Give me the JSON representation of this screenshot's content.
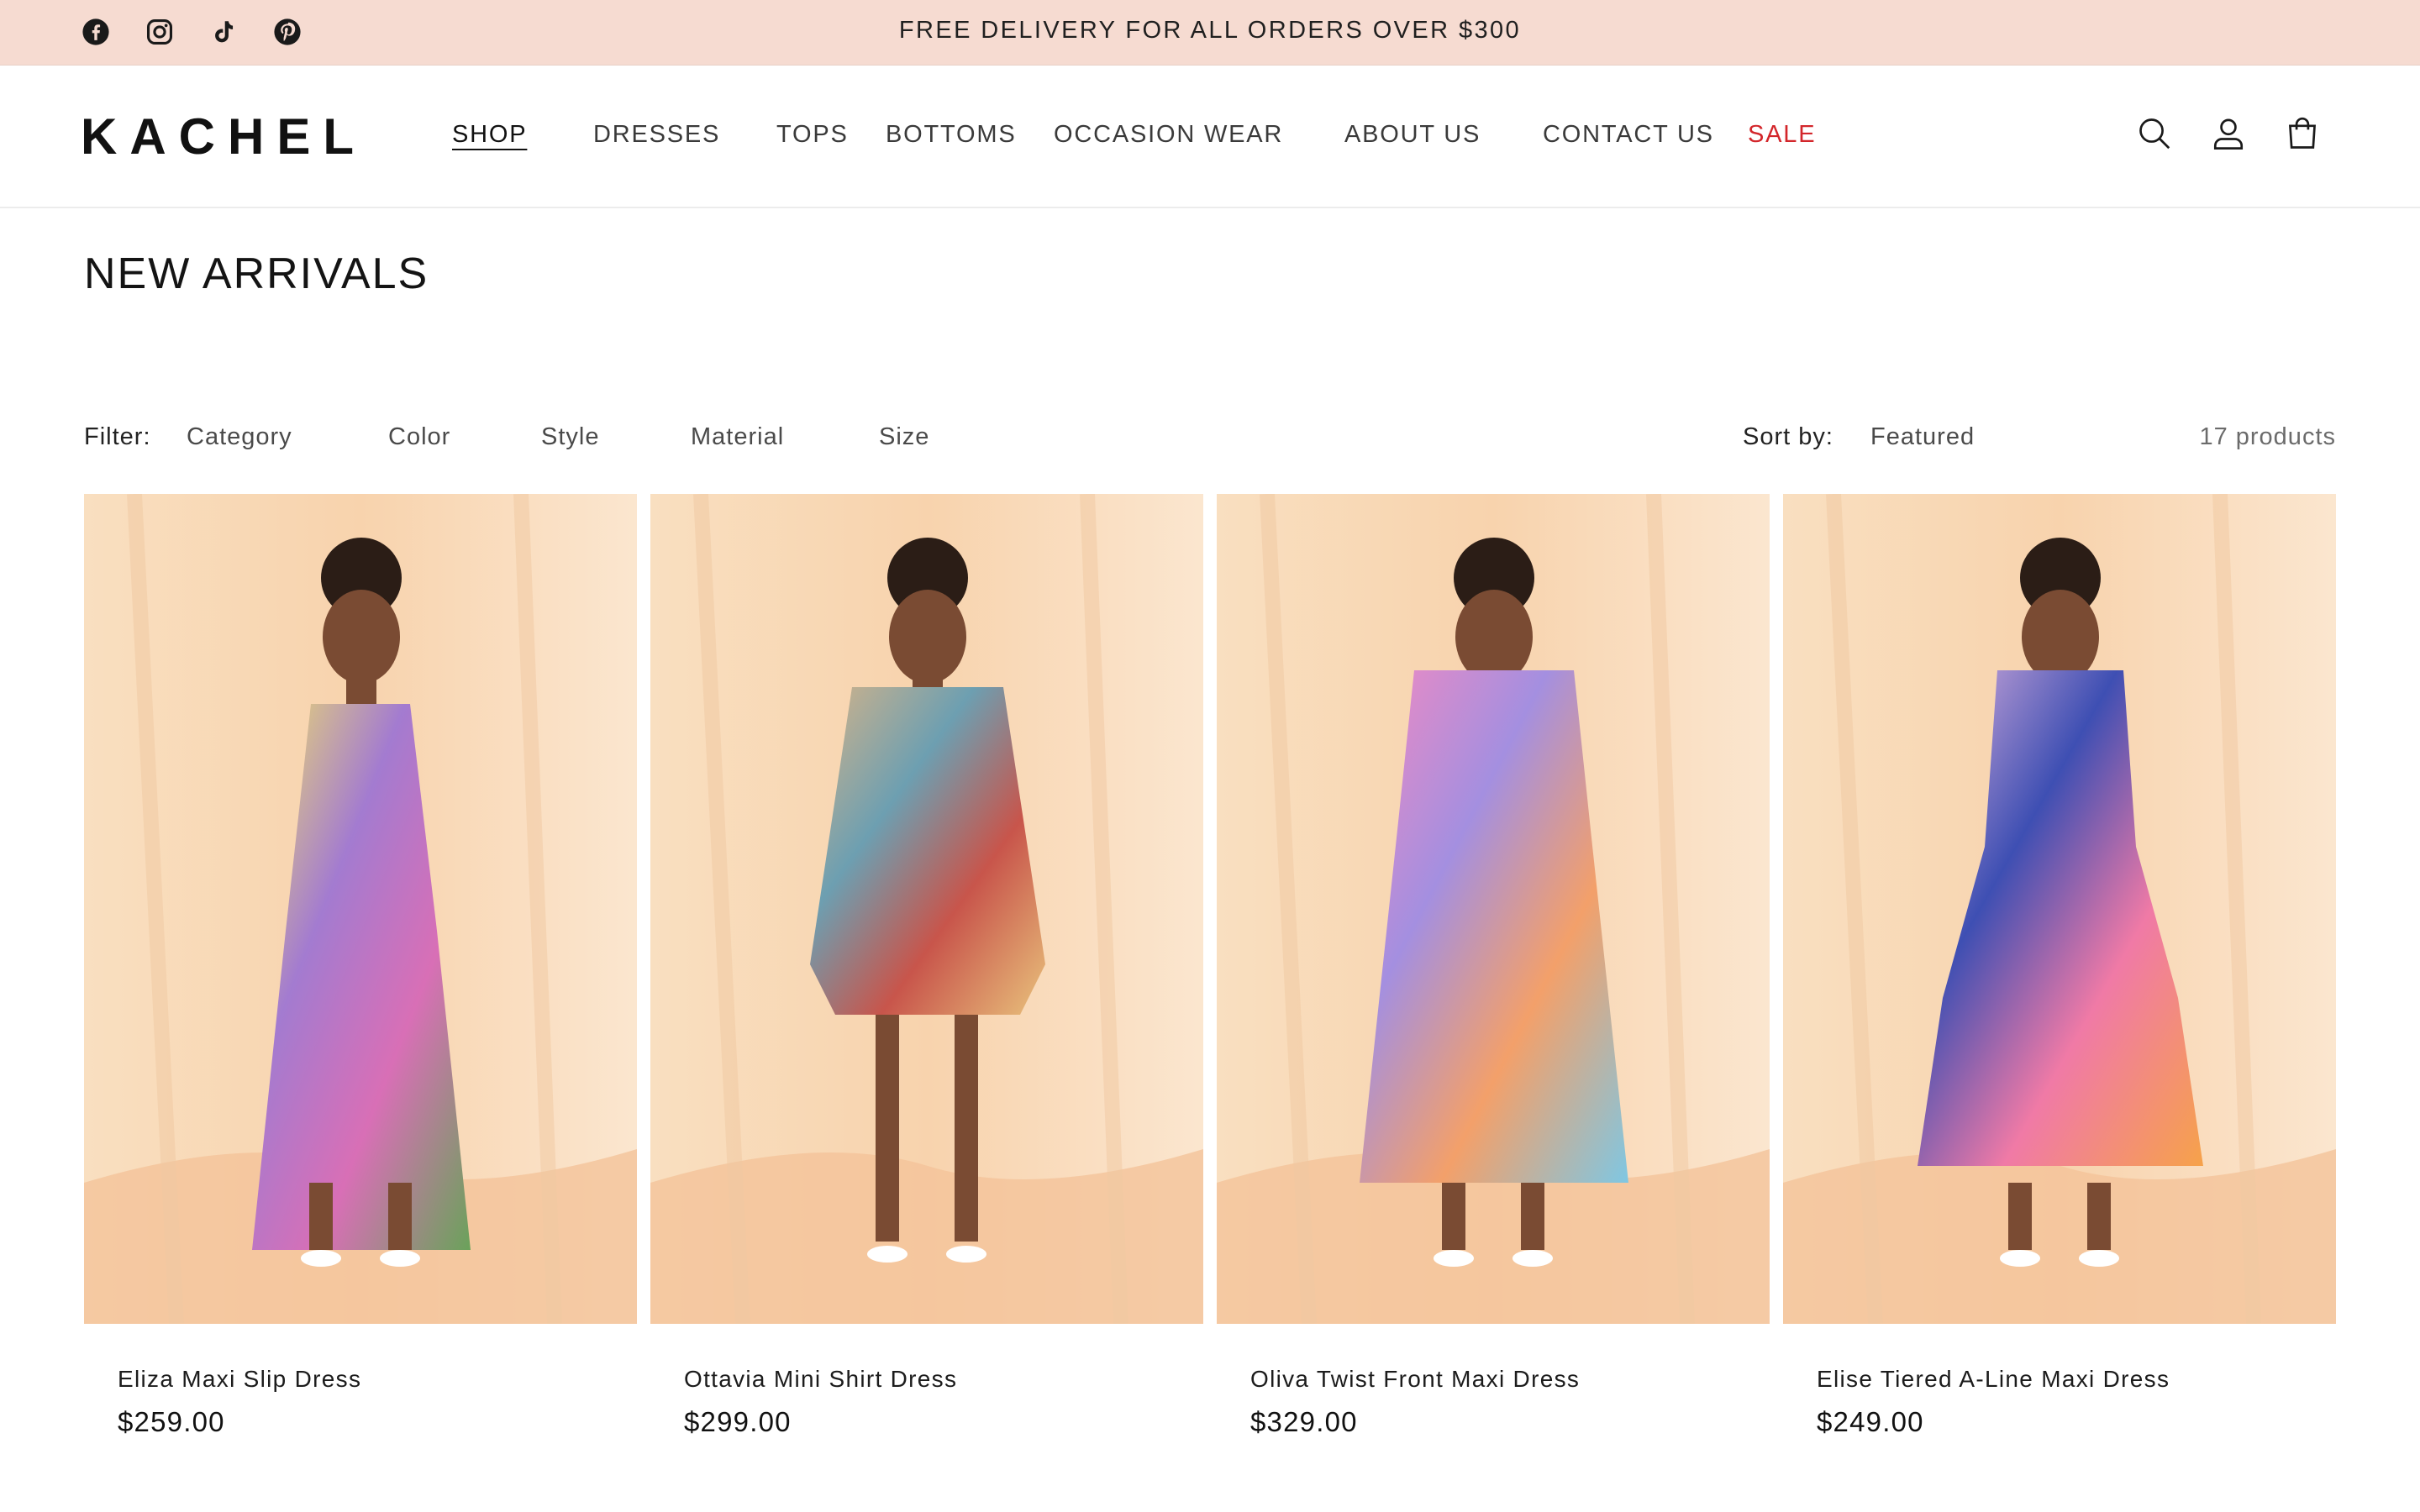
{
  "announcement": {
    "text": "FREE DELIVERY FOR ALL ORDERS OVER $300",
    "socials": [
      "facebook-icon",
      "instagram-icon",
      "tiktok-icon",
      "pinterest-icon"
    ]
  },
  "header": {
    "logo": "KACHEL",
    "nav": [
      {
        "label": "SHOP",
        "active": true
      },
      {
        "label": "DRESSES"
      },
      {
        "label": "TOPS"
      },
      {
        "label": "BOTTOMS"
      },
      {
        "label": "OCCASION WEAR"
      },
      {
        "label": "ABOUT US"
      },
      {
        "label": "CONTACT US"
      },
      {
        "label": "SALE",
        "color": "#d3262b"
      }
    ],
    "icons": [
      "search-icon",
      "account-icon",
      "cart-icon"
    ]
  },
  "page": {
    "title": "NEW ARRIVALS"
  },
  "facets": {
    "filter_label": "Filter:",
    "filters": [
      "Category",
      "Color",
      "Style",
      "Material",
      "Size"
    ],
    "sort_label": "Sort by:",
    "sort_value": "Featured",
    "count": "17 products"
  },
  "products": [
    {
      "title": "Eliza Maxi Slip Dress",
      "price": "$259.00",
      "dress_colors": [
        "#f3e468",
        "#a37bd0",
        "#d86fb6",
        "#6aa25a"
      ]
    },
    {
      "title": "Ottavia Mini Shirt Dress",
      "price": "$299.00",
      "dress_colors": [
        "#d9b487",
        "#6d9fb1",
        "#c8554b",
        "#e9c27c"
      ]
    },
    {
      "title": "Oliva Twist Front Maxi Dress",
      "price": "$329.00",
      "dress_colors": [
        "#f48ac1",
        "#a48fe0",
        "#f3a06a",
        "#7fc7e3"
      ]
    },
    {
      "title": "Elise Tiered A-Line Maxi Dress",
      "price": "$249.00",
      "dress_colors": [
        "#e9b9e0",
        "#3e4fb3",
        "#f07aa6",
        "#f6a24a"
      ]
    }
  ],
  "colors": {
    "announcement_bg": "#f6dbd1",
    "sale": "#d3262b",
    "backdrop": "#f8d3ad"
  }
}
